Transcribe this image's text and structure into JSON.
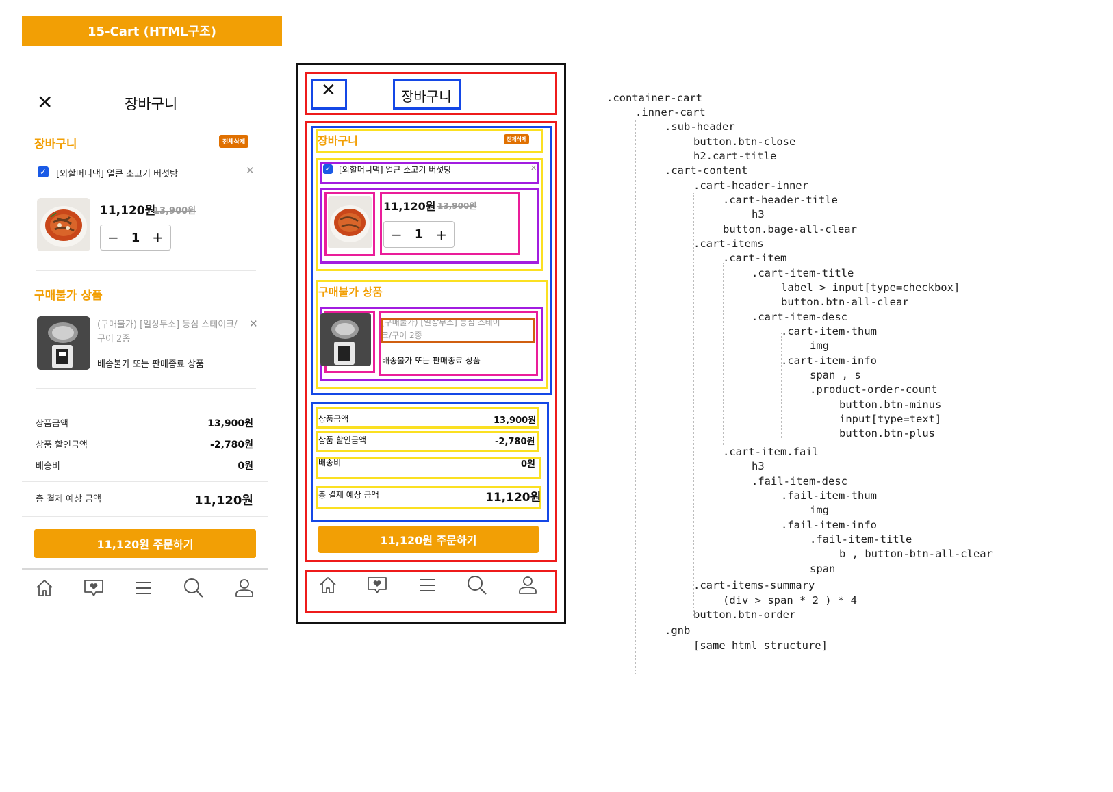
{
  "banner": {
    "title": "15-Cart (HTML구조)"
  },
  "header": {
    "close_glyph": "✕",
    "title": "장바구니"
  },
  "cart": {
    "section_title": "장바구니",
    "clear_all_label": "전체삭제",
    "item": {
      "checked": true,
      "name": "[외할머니댁] 얼큰 소고기 버섯탕",
      "price": "11,120원",
      "original_price": "13,900원",
      "quantity": "1",
      "minus_glyph": "−",
      "plus_glyph": "+"
    },
    "fail": {
      "title": "구매불가 상품",
      "name": "(구매불가) [일상무소] 등심 스테이크/구이 2종",
      "name_line1": "(구매불가) [일상무소] 등심 스테이",
      "name_line2": "크/구이 2종",
      "status": "배송불가 또는 판매종료 상품"
    }
  },
  "summary": {
    "rows": [
      {
        "label": "상품금액",
        "value": "13,900원"
      },
      {
        "label": "상품 할인금액",
        "value": "-2,780원"
      },
      {
        "label": "배송비",
        "value": "0원"
      }
    ],
    "total_label": "총 결제 예상 금액",
    "total_value": "11,120원"
  },
  "order_button": {
    "label": "11,120원 주문하기"
  },
  "gnb": {
    "items": [
      "home-icon",
      "wishlist-heart-icon",
      "menu-icon",
      "search-icon",
      "user-icon"
    ]
  },
  "colors": {
    "accent": "#f29f05",
    "badge": "#e07000",
    "checkbox": "#1a5ae6",
    "wire_red": "#ee1b1b",
    "wire_blue": "#1447e6",
    "wire_yellow": "#fbe021",
    "wire_purple": "#a21ce0",
    "wire_pink": "#ea1d9a",
    "wire_brown": "#d05f10"
  },
  "code_tree": [
    ".container-cart",
    ".inner-cart",
    ".sub-header",
    "button.btn-close",
    "h2.cart-title",
    ".cart-content",
    ".cart-header-inner",
    ".cart-header-title",
    "h3",
    "button.bage-all-clear",
    ".cart-items",
    ".cart-item",
    ".cart-item-title",
    "label > input[type=checkbox]",
    "button.btn-all-clear",
    ".cart-item-desc",
    ".cart-item-thum",
    "img",
    ".cart-item-info",
    "span , s",
    ".product-order-count",
    "button.btn-minus",
    "input[type=text]",
    "button.btn-plus",
    ".cart-item.fail",
    "h3",
    ".fail-item-desc",
    ".fail-item-thum",
    "img",
    ".fail-item-info",
    ".fail-item-title",
    "b , button-btn-all-clear",
    "span",
    ".cart-items-summary",
    "(div > span * 2 ) * 4",
    "button.btn-order",
    ".gnb",
    "[same html structure]"
  ]
}
